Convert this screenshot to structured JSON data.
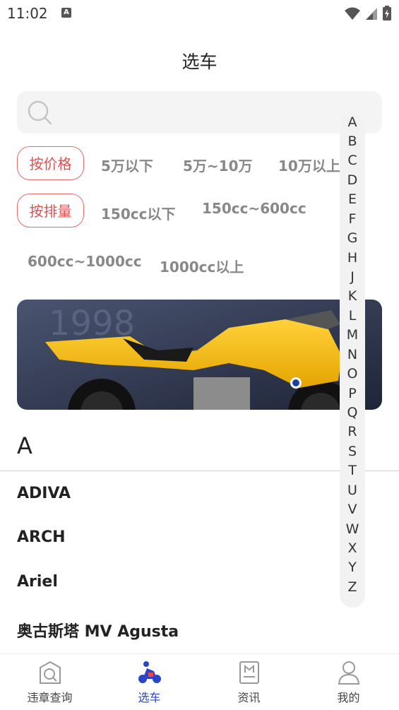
{
  "status": {
    "time": "11:02",
    "notification_icon": "A"
  },
  "header": {
    "title": "选车"
  },
  "search": {
    "placeholder": ""
  },
  "price_filter": {
    "label": "按价格",
    "options": [
      "5万以下",
      "5万~10万",
      "10万以上"
    ]
  },
  "displacement_filter": {
    "label": "按排量",
    "options": [
      "150cc以下",
      "150cc~600cc",
      "600cc~1000cc",
      "1000cc以上"
    ]
  },
  "banner": {
    "image": "yellow-motorcycle-photo"
  },
  "list": {
    "section": "A",
    "brands": [
      "ADIVA",
      "ARCH",
      "Ariel",
      "奥古斯塔 MV Agusta"
    ]
  },
  "index_letters": [
    "A",
    "B",
    "C",
    "D",
    "E",
    "F",
    "G",
    "H",
    "J",
    "K",
    "L",
    "M",
    "N",
    "O",
    "P",
    "Q",
    "R",
    "S",
    "T",
    "U",
    "V",
    "W",
    "X",
    "Y",
    "Z"
  ],
  "tabs": [
    {
      "label": "违章查询",
      "icon": "violation-search-icon"
    },
    {
      "label": "选车",
      "icon": "motorcycle-icon",
      "active": true
    },
    {
      "label": "资讯",
      "icon": "news-icon"
    },
    {
      "label": "我的",
      "icon": "profile-icon"
    }
  ],
  "colors": {
    "accent": "#2a45c8",
    "chip": "#e05050"
  }
}
